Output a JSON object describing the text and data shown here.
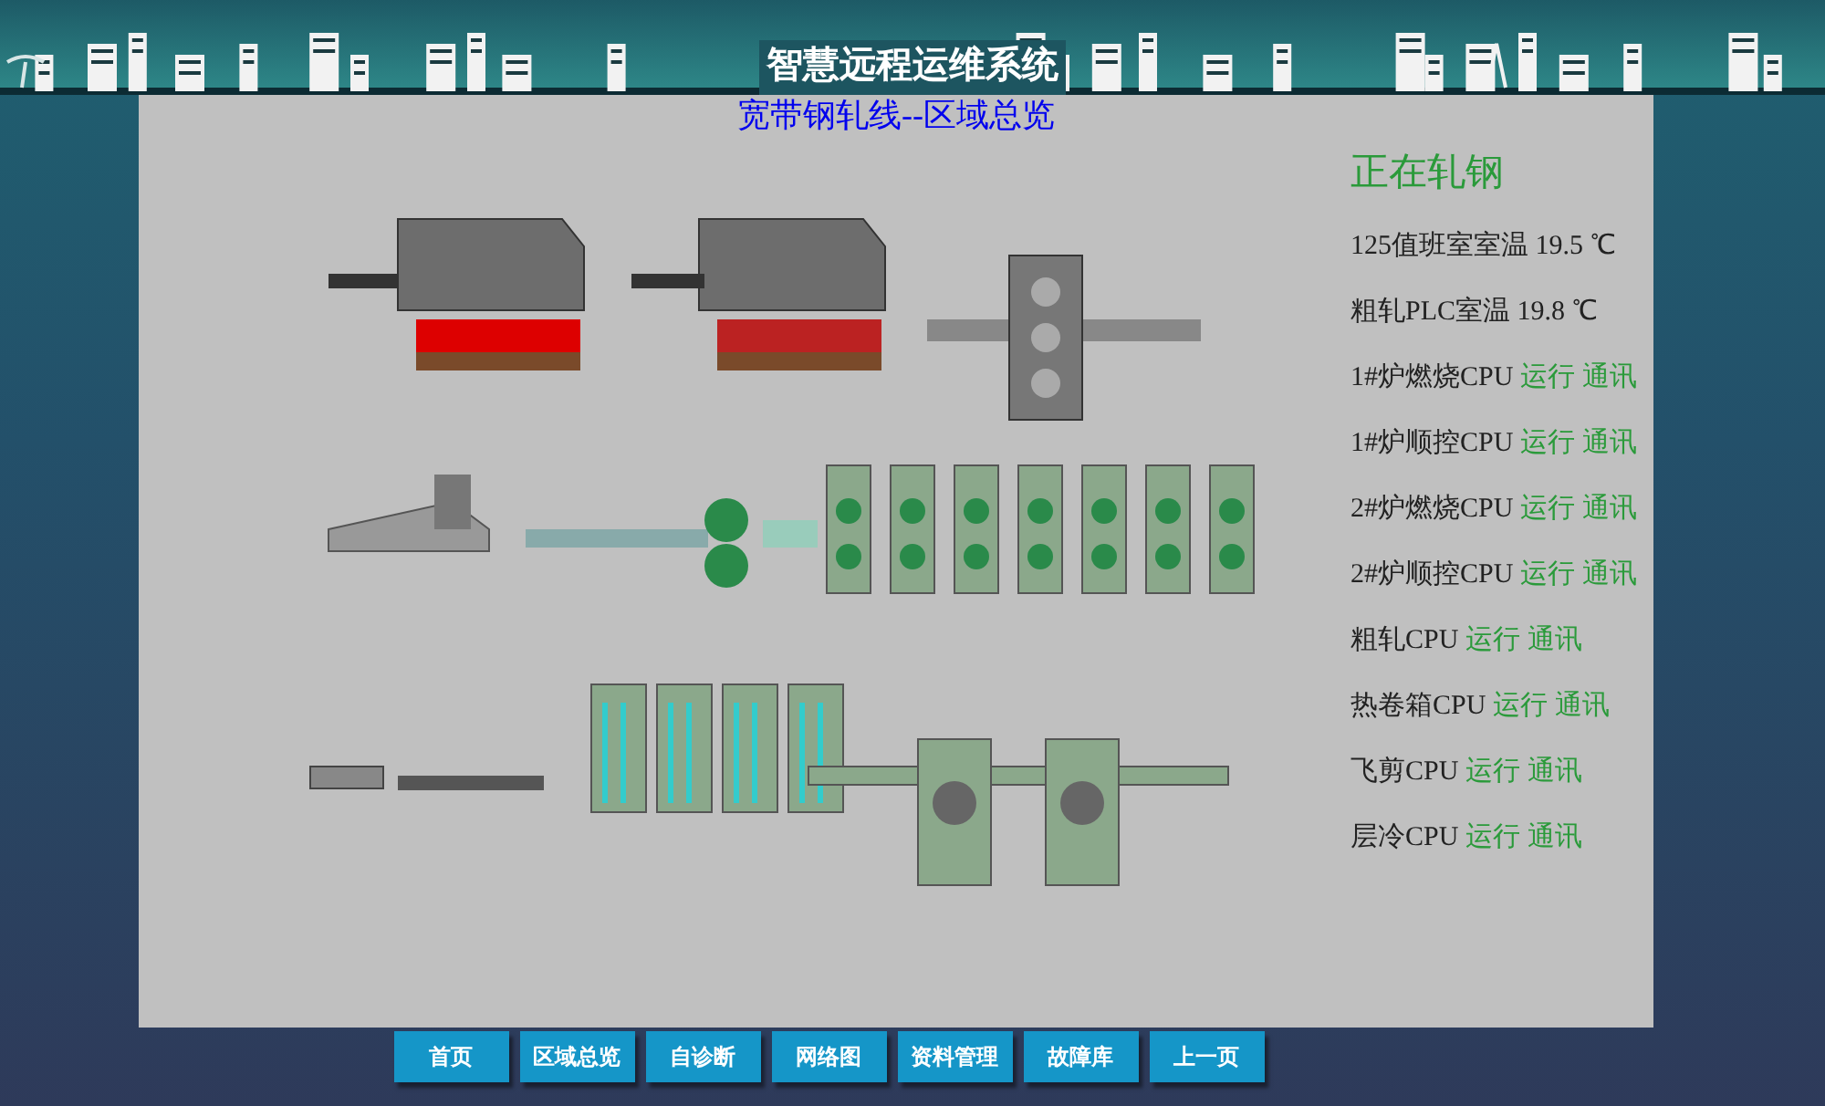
{
  "header": {
    "title": "智慧远程运维系统"
  },
  "page_title": "宽带钢轧线--区域总览",
  "status_panel": {
    "heading": "正在轧钢",
    "items": [
      {
        "kind": "reading",
        "label": "125值班室室温 19.5 ℃"
      },
      {
        "kind": "reading",
        "label": "粗轧PLC室温 19.8 ℃"
      },
      {
        "kind": "cpu",
        "label": "1#炉燃烧CPU",
        "run": "运行",
        "comm": "通讯"
      },
      {
        "kind": "cpu",
        "label": "1#炉顺控CPU",
        "run": "运行",
        "comm": "通讯"
      },
      {
        "kind": "cpu",
        "label": "2#炉燃烧CPU",
        "run": "运行",
        "comm": "通讯"
      },
      {
        "kind": "cpu",
        "label": "2#炉顺控CPU",
        "run": "运行",
        "comm": "通讯"
      },
      {
        "kind": "cpu",
        "label": "粗轧CPU",
        "run": "运行",
        "comm": "通讯"
      },
      {
        "kind": "cpu",
        "label": "热卷箱CPU",
        "run": "运行",
        "comm": "通讯"
      },
      {
        "kind": "cpu",
        "label": "飞剪CPU",
        "run": "运行",
        "comm": "通讯"
      },
      {
        "kind": "cpu",
        "label": "层冷CPU",
        "run": "运行",
        "comm": "通讯"
      }
    ]
  },
  "nav": [
    "首页",
    "区域总览",
    "自诊断",
    "网络图",
    "资料管理",
    "故障库",
    "上一页"
  ]
}
